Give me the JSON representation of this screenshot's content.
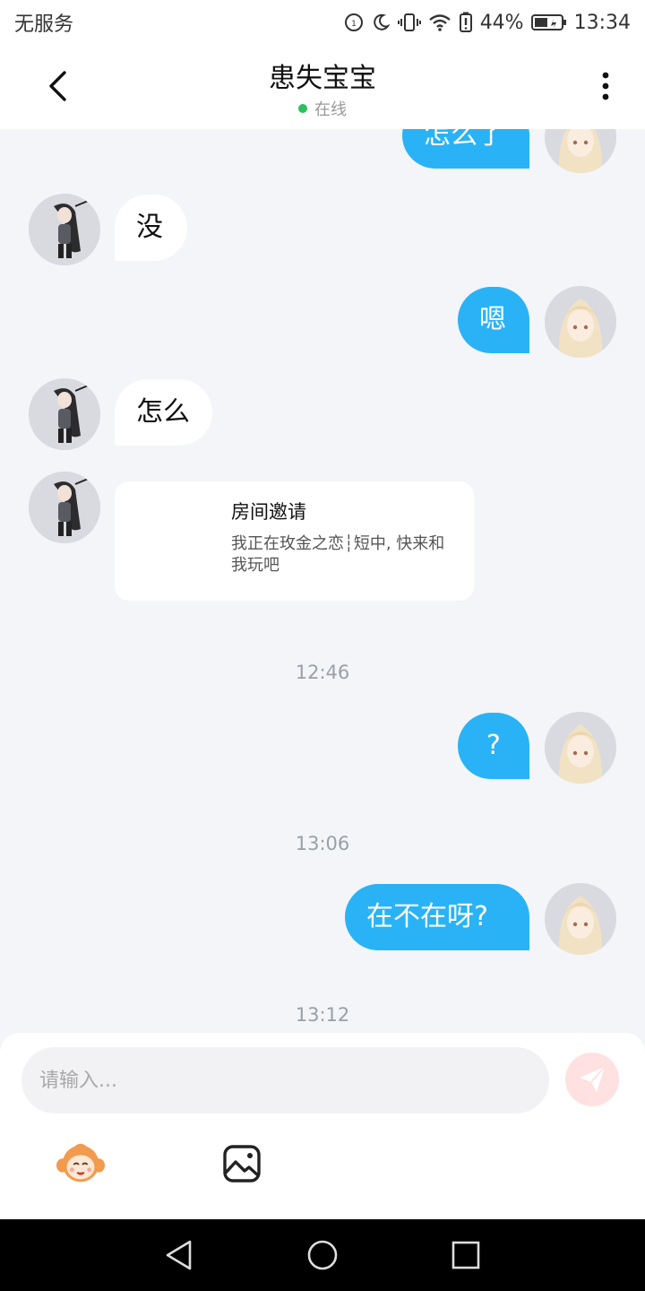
{
  "status_bar": {
    "carrier": "无服务",
    "battery_percent": "44%",
    "time": "13:34"
  },
  "header": {
    "title": "患失宝宝",
    "status": "在线"
  },
  "messages": {
    "m1": "怎么了",
    "m2": "没",
    "m3": "嗯",
    "m4": "怎么",
    "invite_title": "房间邀请",
    "invite_text": "我正在玫金之恋┆短中, 快来和我玩吧",
    "t1": "12:46",
    "m5": "?",
    "t2": "13:06",
    "m6": "在不在呀?",
    "t3": "13:12"
  },
  "composer": {
    "placeholder": "请输入..."
  },
  "colors": {
    "accent": "#29b3f6",
    "online": "#2ac05a",
    "send_bg": "#ffe1e1"
  }
}
